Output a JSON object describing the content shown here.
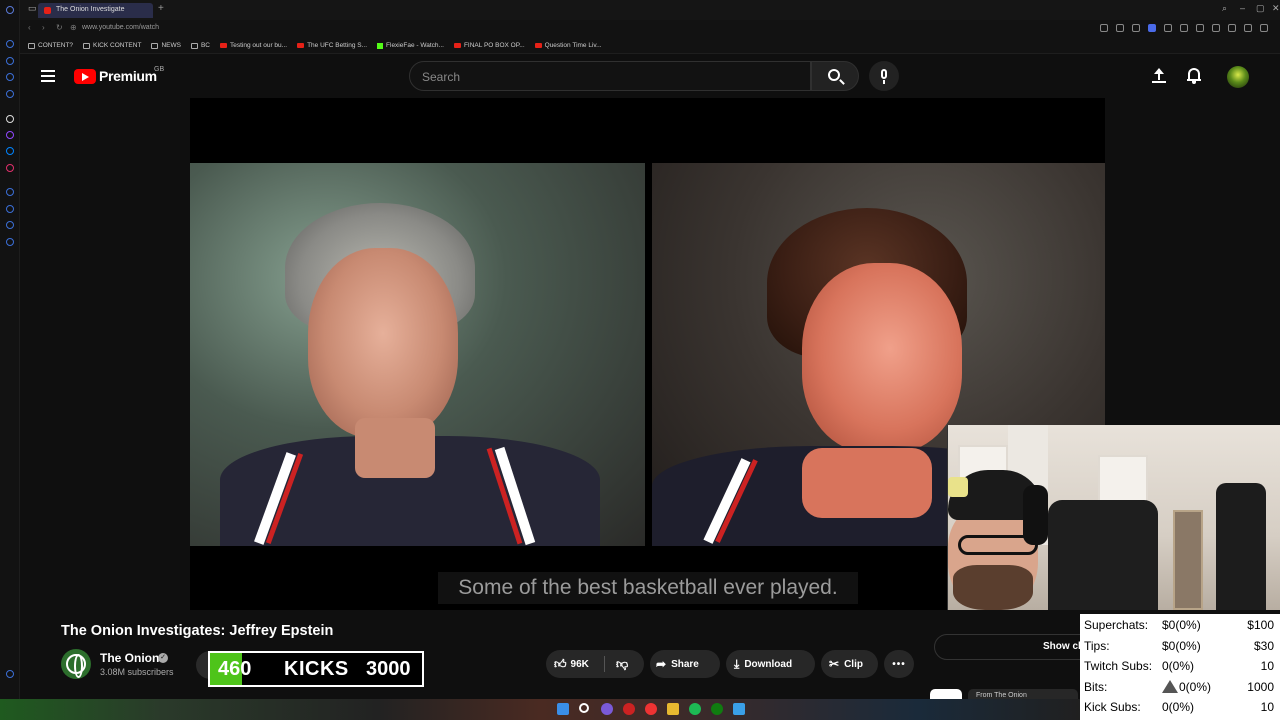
{
  "browser": {
    "tab_title": "The Onion Investigate",
    "url": "www.youtube.com/watch",
    "bookmarks": [
      {
        "label": "CONTENT?",
        "kind": "folder"
      },
      {
        "label": "KICK CONTENT",
        "kind": "folder"
      },
      {
        "label": "NEWS",
        "kind": "folder"
      },
      {
        "label": "BC",
        "kind": "folder"
      },
      {
        "label": "Testing out our bu...",
        "kind": "youtube"
      },
      {
        "label": "The UFC Betting S...",
        "kind": "youtube"
      },
      {
        "label": "FlexieFae - Watch...",
        "kind": "kick"
      },
      {
        "label": "FINAL PO BOX OP...",
        "kind": "youtube"
      },
      {
        "label": "Question Time Liv...",
        "kind": "youtube"
      }
    ]
  },
  "youtube": {
    "logo_text": "Premium",
    "region": "GB",
    "search_placeholder": "Search"
  },
  "video": {
    "subtitle": "Some of the best basketball ever played.",
    "title": "The Onion Investigates: Jeffrey Epstein",
    "channel_name": "The Onion",
    "subscribers": "3.08M subscribers",
    "likes": "96K",
    "share_label": "Share",
    "download_label": "Download",
    "clip_label": "Clip",
    "more_label": "•••",
    "show_chat_label": "Show chat",
    "chip_label": "From The Onion"
  },
  "kicks_goal": {
    "current": "460",
    "label": "KICKS",
    "goal": "3000",
    "progress_fraction": 0.153,
    "fill_color": "#4ec41a"
  },
  "stats": [
    {
      "label": "Superchats:",
      "value": "$0(0%)",
      "goal": "$100",
      "icon": ""
    },
    {
      "label": "Tips:",
      "value": "$0(0%)",
      "goal": "$30",
      "icon": ""
    },
    {
      "label": "Twitch Subs:",
      "value": "0(0%)",
      "goal": "10",
      "icon": ""
    },
    {
      "label": "Bits:",
      "value": "0(0%)",
      "goal": "1000",
      "icon": "warning-triangle"
    },
    {
      "label": "Kick Subs:",
      "value": "0(0%)",
      "goal": "10",
      "icon": ""
    }
  ],
  "colors": {
    "youtube_red": "#ff0000",
    "background": "#0f0f0f",
    "kick_green": "#53fc18"
  }
}
